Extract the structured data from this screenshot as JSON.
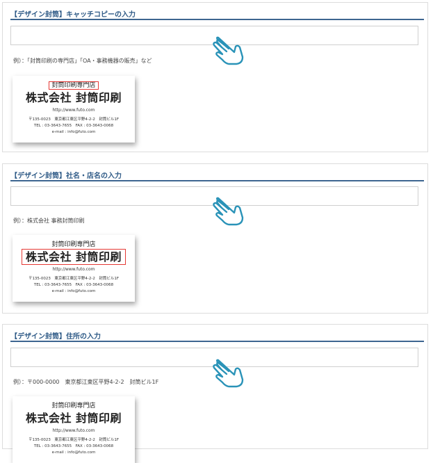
{
  "accent_color": "#2f5b87",
  "highlight_color": "#e53935",
  "icons": [
    "pointing-hand-icon"
  ],
  "sections": [
    {
      "title": "【デザイン封筒】キャッチコピーの入力",
      "input_value": "",
      "example": "例）：「封筒印刷の専門店」「OA・事務機器の販売」など",
      "highlight": "shop"
    },
    {
      "title": "【デザイン封筒】社名・店名の入力",
      "input_value": "",
      "example": "例）：株式会社 事務封筒印刷",
      "highlight": "company"
    },
    {
      "title": "【デザイン封筒】住所の入力",
      "input_value": "",
      "example": "例）：〒000-0000　東京都江東区平野4-2-2　封筒ビル1F",
      "highlight": "address"
    }
  ],
  "card": {
    "shop": "封筒印刷専門店",
    "company": "株式会社 封筒印刷",
    "url": "http://www.futo.com",
    "address": "〒135-0023　東京都江東区平野4-2-2　封筒ビル1F",
    "tel": "TEL : 03-3643-7655　FAX : 03-3643-0068",
    "mail": "e-mail : info@futo.com"
  }
}
